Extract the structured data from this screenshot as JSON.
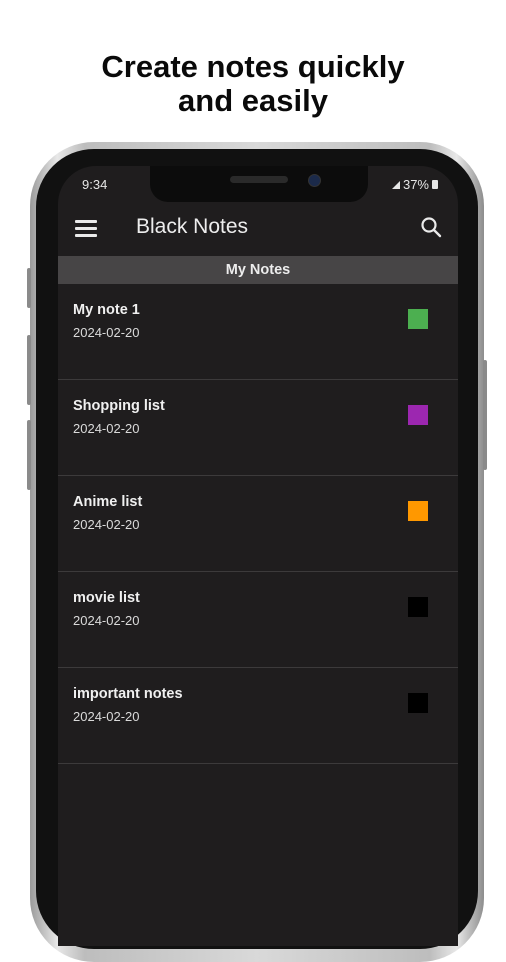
{
  "headline": {
    "line1": "Create notes quickly",
    "line2": "and easily"
  },
  "status": {
    "time": "9:34",
    "battery": "37%"
  },
  "app": {
    "title": "Black Notes",
    "section": "My Notes"
  },
  "notes": [
    {
      "title": "My note 1",
      "date": "2024-02-20",
      "color": "#4caf50"
    },
    {
      "title": "Shopping list",
      "date": "2024-02-20",
      "color": "#9c27b0"
    },
    {
      "title": "Anime list",
      "date": "2024-02-20",
      "color": "#ff9800"
    },
    {
      "title": "movie list",
      "date": "2024-02-20",
      "color": "#000000"
    },
    {
      "title": "important notes",
      "date": "2024-02-20",
      "color": "#000000"
    }
  ],
  "colors": {
    "background": "#1f1d1e",
    "section_header": "#474546",
    "divider": "#3c3a3b"
  },
  "icons": {
    "menu": "hamburger-menu-icon",
    "search": "search-icon"
  }
}
